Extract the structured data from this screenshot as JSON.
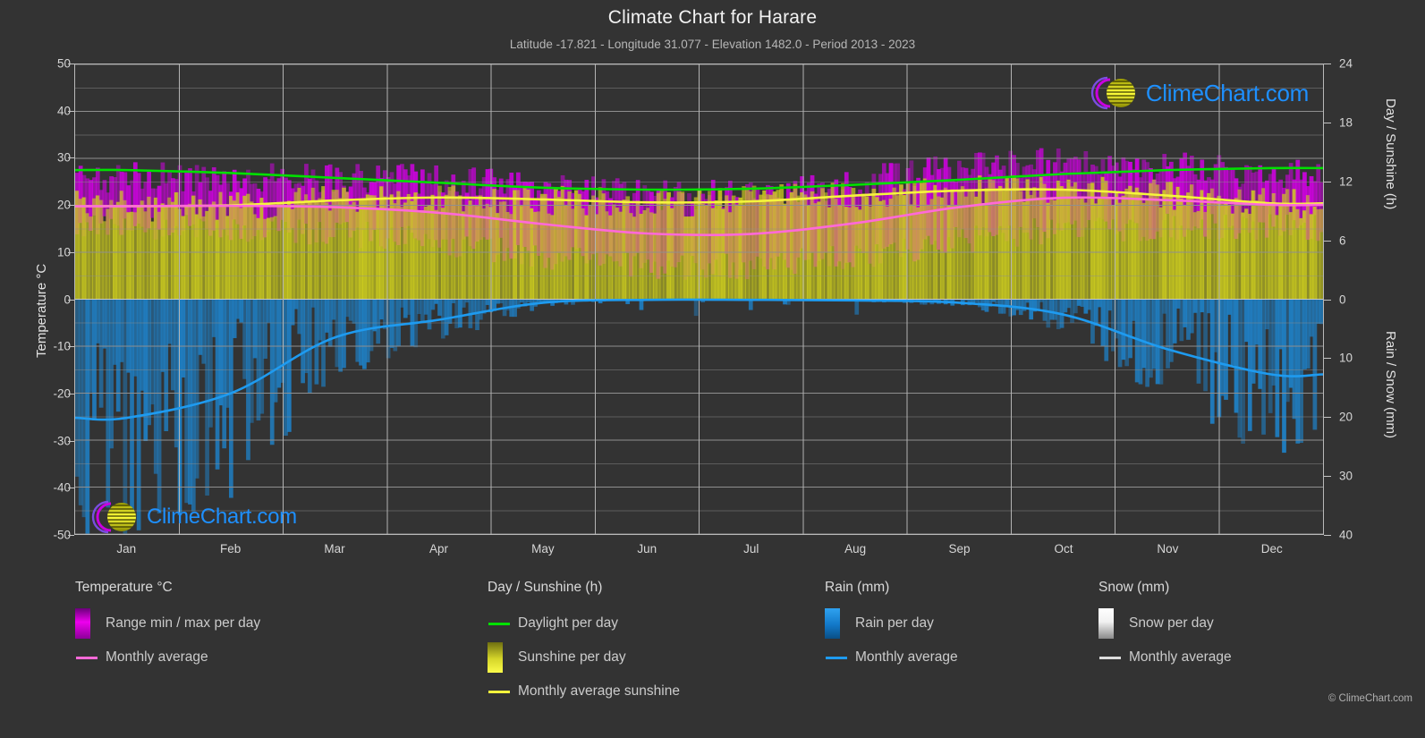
{
  "header": {
    "title": "Climate Chart for Harare",
    "subtitle": "Latitude -17.821 - Longitude 31.077 - Elevation 1482.0 - Period 2013 - 2023"
  },
  "branding": {
    "wordmark": "ClimeChart.com",
    "copyright": "© ClimeChart.com"
  },
  "axes": {
    "left_title": "Temperature °C",
    "right_top_title": "Day / Sunshine (h)",
    "right_bottom_title": "Rain / Snow (mm)",
    "left_ticks": [
      "50",
      "40",
      "30",
      "20",
      "10",
      "0",
      "-10",
      "-20",
      "-30",
      "-40",
      "-50"
    ],
    "right_top_ticks": [
      "24",
      "18",
      "12",
      "6",
      "0"
    ],
    "right_bottom_ticks": [
      "0",
      "10",
      "20",
      "30",
      "40"
    ],
    "x_ticks": [
      "Jan",
      "Feb",
      "Mar",
      "Apr",
      "May",
      "Jun",
      "Jul",
      "Aug",
      "Sep",
      "Oct",
      "Nov",
      "Dec"
    ]
  },
  "legend": {
    "columns": [
      {
        "heading": "Temperature °C",
        "items": [
          {
            "label": "Range min / max per day",
            "key": "swatch",
            "color": "#e000e0"
          },
          {
            "label": "Monthly average",
            "key": "line",
            "color": "#ff69d8"
          }
        ]
      },
      {
        "heading": "Day / Sunshine (h)",
        "items": [
          {
            "label": "Daylight per day",
            "key": "line",
            "color": "#00e000"
          },
          {
            "label": "Sunshine per day",
            "key": "swatch",
            "color": "#f2f22a"
          },
          {
            "label": "Monthly average sunshine",
            "key": "line",
            "color": "#f5f53c"
          }
        ]
      },
      {
        "heading": "Rain (mm)",
        "items": [
          {
            "label": "Rain per day",
            "key": "swatch",
            "color": "#1083d6"
          },
          {
            "label": "Monthly average",
            "key": "line",
            "color": "#1e9bf0"
          }
        ]
      },
      {
        "heading": "Snow (mm)",
        "items": [
          {
            "label": "Snow per day",
            "key": "swatch",
            "color": "#ffffff"
          },
          {
            "label": "Monthly average",
            "key": "line",
            "color": "#dddddd"
          }
        ]
      }
    ]
  },
  "chart_data": {
    "type": "line",
    "title": "Climate Chart for Harare",
    "subtitle": "Latitude -17.821 - Longitude 31.077 - Elevation 1482.0 - Period 2013 - 2023",
    "xlabel": "",
    "ylabel": "Temperature °C",
    "ylim": [
      -50,
      50
    ],
    "y2_top_label": "Day / Sunshine (h)",
    "y2_top_lim": [
      0,
      24
    ],
    "y2_bottom_label": "Rain / Snow (mm)",
    "y2_bottom_lim": [
      0,
      40
    ],
    "grid": true,
    "legend_position": "bottom",
    "categories": [
      "Jan",
      "Feb",
      "Mar",
      "Apr",
      "May",
      "Jun",
      "Jul",
      "Aug",
      "Sep",
      "Oct",
      "Nov",
      "Dec"
    ],
    "series": [
      {
        "name": "Monthly average temperature",
        "unit": "°C",
        "color": "#ff69d8",
        "values": [
          19.8,
          19.9,
          19.6,
          18.4,
          16.0,
          14.0,
          13.9,
          16.2,
          19.6,
          21.6,
          21.1,
          20.1
        ]
      },
      {
        "name": "Daily max temperature (band top)",
        "unit": "°C",
        "color": "#e000e0",
        "values": [
          25.6,
          25.8,
          25.7,
          25.3,
          23.6,
          21.9,
          22.0,
          24.6,
          27.8,
          29.3,
          28.2,
          26.2
        ]
      },
      {
        "name": "Daily min temperature (band bottom)",
        "unit": "°C",
        "color": "#e000e0",
        "values": [
          15.3,
          15.3,
          14.6,
          12.6,
          9.6,
          7.2,
          7.1,
          9.4,
          12.9,
          15.4,
          15.8,
          15.4
        ]
      },
      {
        "name": "Daylight per day",
        "unit": "h",
        "color": "#00e000",
        "values": [
          13.2,
          12.9,
          12.4,
          11.9,
          11.4,
          11.2,
          11.3,
          11.7,
          12.2,
          12.8,
          13.2,
          13.4
        ]
      },
      {
        "name": "Monthly average sunshine",
        "unit": "h",
        "color": "#f5f53c",
        "values": [
          9.5,
          9.6,
          10.1,
          10.4,
          10.2,
          9.9,
          10.0,
          10.6,
          11.1,
          11.2,
          10.6,
          9.8
        ]
      },
      {
        "name": "Rain monthly average",
        "unit": "mm",
        "color": "#1e9bf0",
        "values": [
          20.2,
          16.0,
          6.5,
          3.5,
          0.6,
          0.1,
          0.1,
          0.2,
          0.6,
          2.6,
          8.5,
          12.8
        ]
      },
      {
        "name": "Snow monthly average",
        "unit": "mm",
        "color": "#dddddd",
        "values": [
          0,
          0,
          0,
          0,
          0,
          0,
          0,
          0,
          0,
          0,
          0,
          0
        ]
      }
    ],
    "annotations": [
      "Temperature range band (daily min/max) shown as magenta vertical bars",
      "Sunshine per day shown as olive/yellow vertical bars from 0 upward",
      "Rain per day shown as blue vertical bars below the zero line"
    ]
  }
}
